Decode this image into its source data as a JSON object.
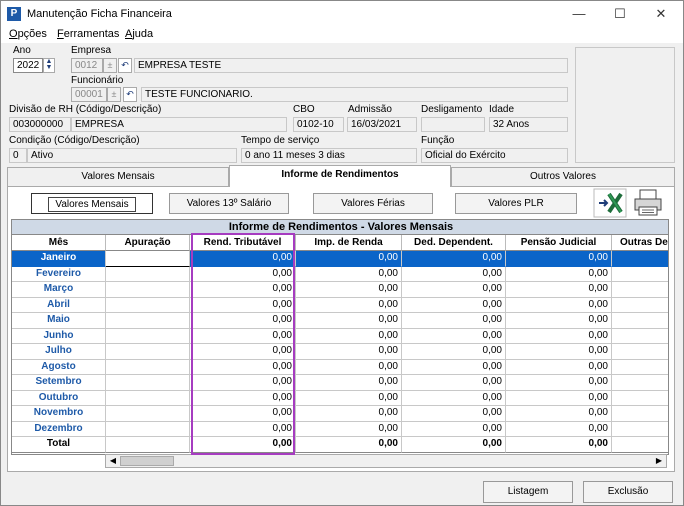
{
  "window": {
    "title": "Manutenção Ficha Financeira",
    "minimize": "—",
    "maximize": "☐",
    "close": "✕",
    "app_icon": "P"
  },
  "menu": [
    {
      "label": "Opções",
      "accel": "O",
      "rest": "pções"
    },
    {
      "label": "Ferramentas",
      "accel": "F",
      "rest": "erramentas"
    },
    {
      "label": "Ajuda",
      "accel": "A",
      "rest": "juda"
    }
  ],
  "form": {
    "ano_label": "Ano",
    "ano_value": "2022",
    "empresa_label": "Empresa",
    "empresa_code": "0012",
    "empresa_name": "EMPRESA TESTE",
    "funcionario_label": "Funcionário",
    "funcionario_code": "00001",
    "funcionario_name": "TESTE FUNCIONARIO.",
    "divisao_label": "Divisão de RH (Código/Descrição)",
    "divisao_code": "003000000",
    "divisao_desc": "EMPRESA",
    "cbo_label": "CBO",
    "cbo_value": "0102-10",
    "admissao_label": "Admissão",
    "admissao_value": "16/03/2021",
    "desligamento_label": "Desligamento",
    "desligamento_value": "",
    "idade_label": "Idade",
    "idade_value": "32 Anos",
    "condicao_label": "Condição (Código/Descrição)",
    "condicao_code": "0",
    "condicao_desc": "Ativo",
    "tempo_label": "Tempo de serviço",
    "tempo_value": "0 ano 11 meses 3 dias",
    "funcao_label": "Função",
    "funcao_value": "Oficial do Exército"
  },
  "tabs": [
    {
      "label": "Valores Mensais"
    },
    {
      "label": "Informe de Rendimentos"
    },
    {
      "label": "Outros Valores"
    }
  ],
  "subbuttons": [
    {
      "label": "Valores Mensais"
    },
    {
      "label": "Valores 13º Salário"
    },
    {
      "label": "Valores Férias"
    },
    {
      "label": "Valores PLR"
    }
  ],
  "grid": {
    "title": "Informe de Rendimentos - Valores Mensais",
    "columns": [
      "Mês",
      "Apuração",
      "Rend. Tributável",
      "Imp. de Renda",
      "Ded. Dependent.",
      "Pensão Judicial",
      "Outras De"
    ],
    "rows": [
      {
        "mes": "Janeiro",
        "apuracao": "",
        "v": [
          "0,00",
          "0,00",
          "0,00",
          "0,00"
        ]
      },
      {
        "mes": "Fevereiro",
        "apuracao": "",
        "v": [
          "0,00",
          "0,00",
          "0,00",
          "0,00"
        ]
      },
      {
        "mes": "Março",
        "apuracao": "",
        "v": [
          "0,00",
          "0,00",
          "0,00",
          "0,00"
        ]
      },
      {
        "mes": "Abril",
        "apuracao": "",
        "v": [
          "0,00",
          "0,00",
          "0,00",
          "0,00"
        ]
      },
      {
        "mes": "Maio",
        "apuracao": "",
        "v": [
          "0,00",
          "0,00",
          "0,00",
          "0,00"
        ]
      },
      {
        "mes": "Junho",
        "apuracao": "",
        "v": [
          "0,00",
          "0,00",
          "0,00",
          "0,00"
        ]
      },
      {
        "mes": "Julho",
        "apuracao": "",
        "v": [
          "0,00",
          "0,00",
          "0,00",
          "0,00"
        ]
      },
      {
        "mes": "Agosto",
        "apuracao": "",
        "v": [
          "0,00",
          "0,00",
          "0,00",
          "0,00"
        ]
      },
      {
        "mes": "Setembro",
        "apuracao": "",
        "v": [
          "0,00",
          "0,00",
          "0,00",
          "0,00"
        ]
      },
      {
        "mes": "Outubro",
        "apuracao": "",
        "v": [
          "0,00",
          "0,00",
          "0,00",
          "0,00"
        ]
      },
      {
        "mes": "Novembro",
        "apuracao": "",
        "v": [
          "0,00",
          "0,00",
          "0,00",
          "0,00"
        ]
      },
      {
        "mes": "Dezembro",
        "apuracao": "",
        "v": [
          "0,00",
          "0,00",
          "0,00",
          "0,00"
        ]
      }
    ],
    "total": {
      "mes": "Total",
      "v": [
        "0,00",
        "0,00",
        "0,00",
        "0,00"
      ]
    }
  },
  "bottom": {
    "listagem": "Listagem",
    "exclusao": "Exclusão"
  },
  "icons": {
    "excel": "excel-export-icon",
    "printer": "printer-icon"
  },
  "colors": {
    "selected_row": "#0a64c8",
    "highlight": "#a63cc0",
    "month_text": "#1e5aa8"
  }
}
